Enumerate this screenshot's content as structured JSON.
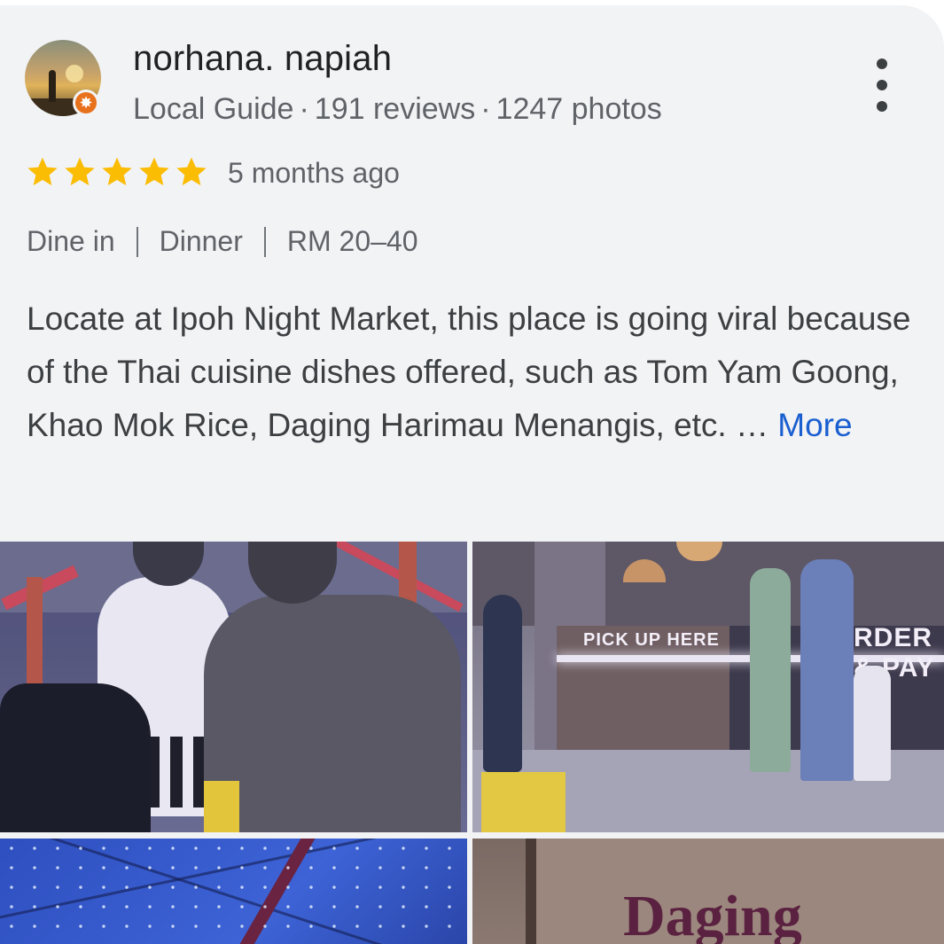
{
  "review": {
    "author": "norhana. napiah",
    "meta": {
      "role": "Local Guide",
      "reviews": "191 reviews",
      "photos": "1247 photos",
      "separator": "·"
    },
    "rating": 5,
    "rating_max": 5,
    "time_ago": "5 months ago",
    "attributes": [
      "Dine in",
      "Dinner",
      "RM 20–40"
    ],
    "text": "Locate at Ipoh Night Market, this place is going viral because of the Thai cuisine dishes offered, such as Tom Yam Goong, Khao Mok Rice, Daging Harimau Menangis, etc. … ",
    "more_label": "More"
  },
  "photos": {
    "photo2_sign_left": "PICK UP HERE",
    "photo2_sign_right": "RDER & PAY",
    "photo4_sign": "Daging"
  },
  "icons": {
    "avatar_badge": "local-guide-badge-icon",
    "menu": "more-vert-icon",
    "star": "star-icon"
  },
  "colors": {
    "star": "#fbbc04",
    "link": "#1a5fd0",
    "badge": "#e8711c",
    "card_bg": "#f2f3f5"
  }
}
